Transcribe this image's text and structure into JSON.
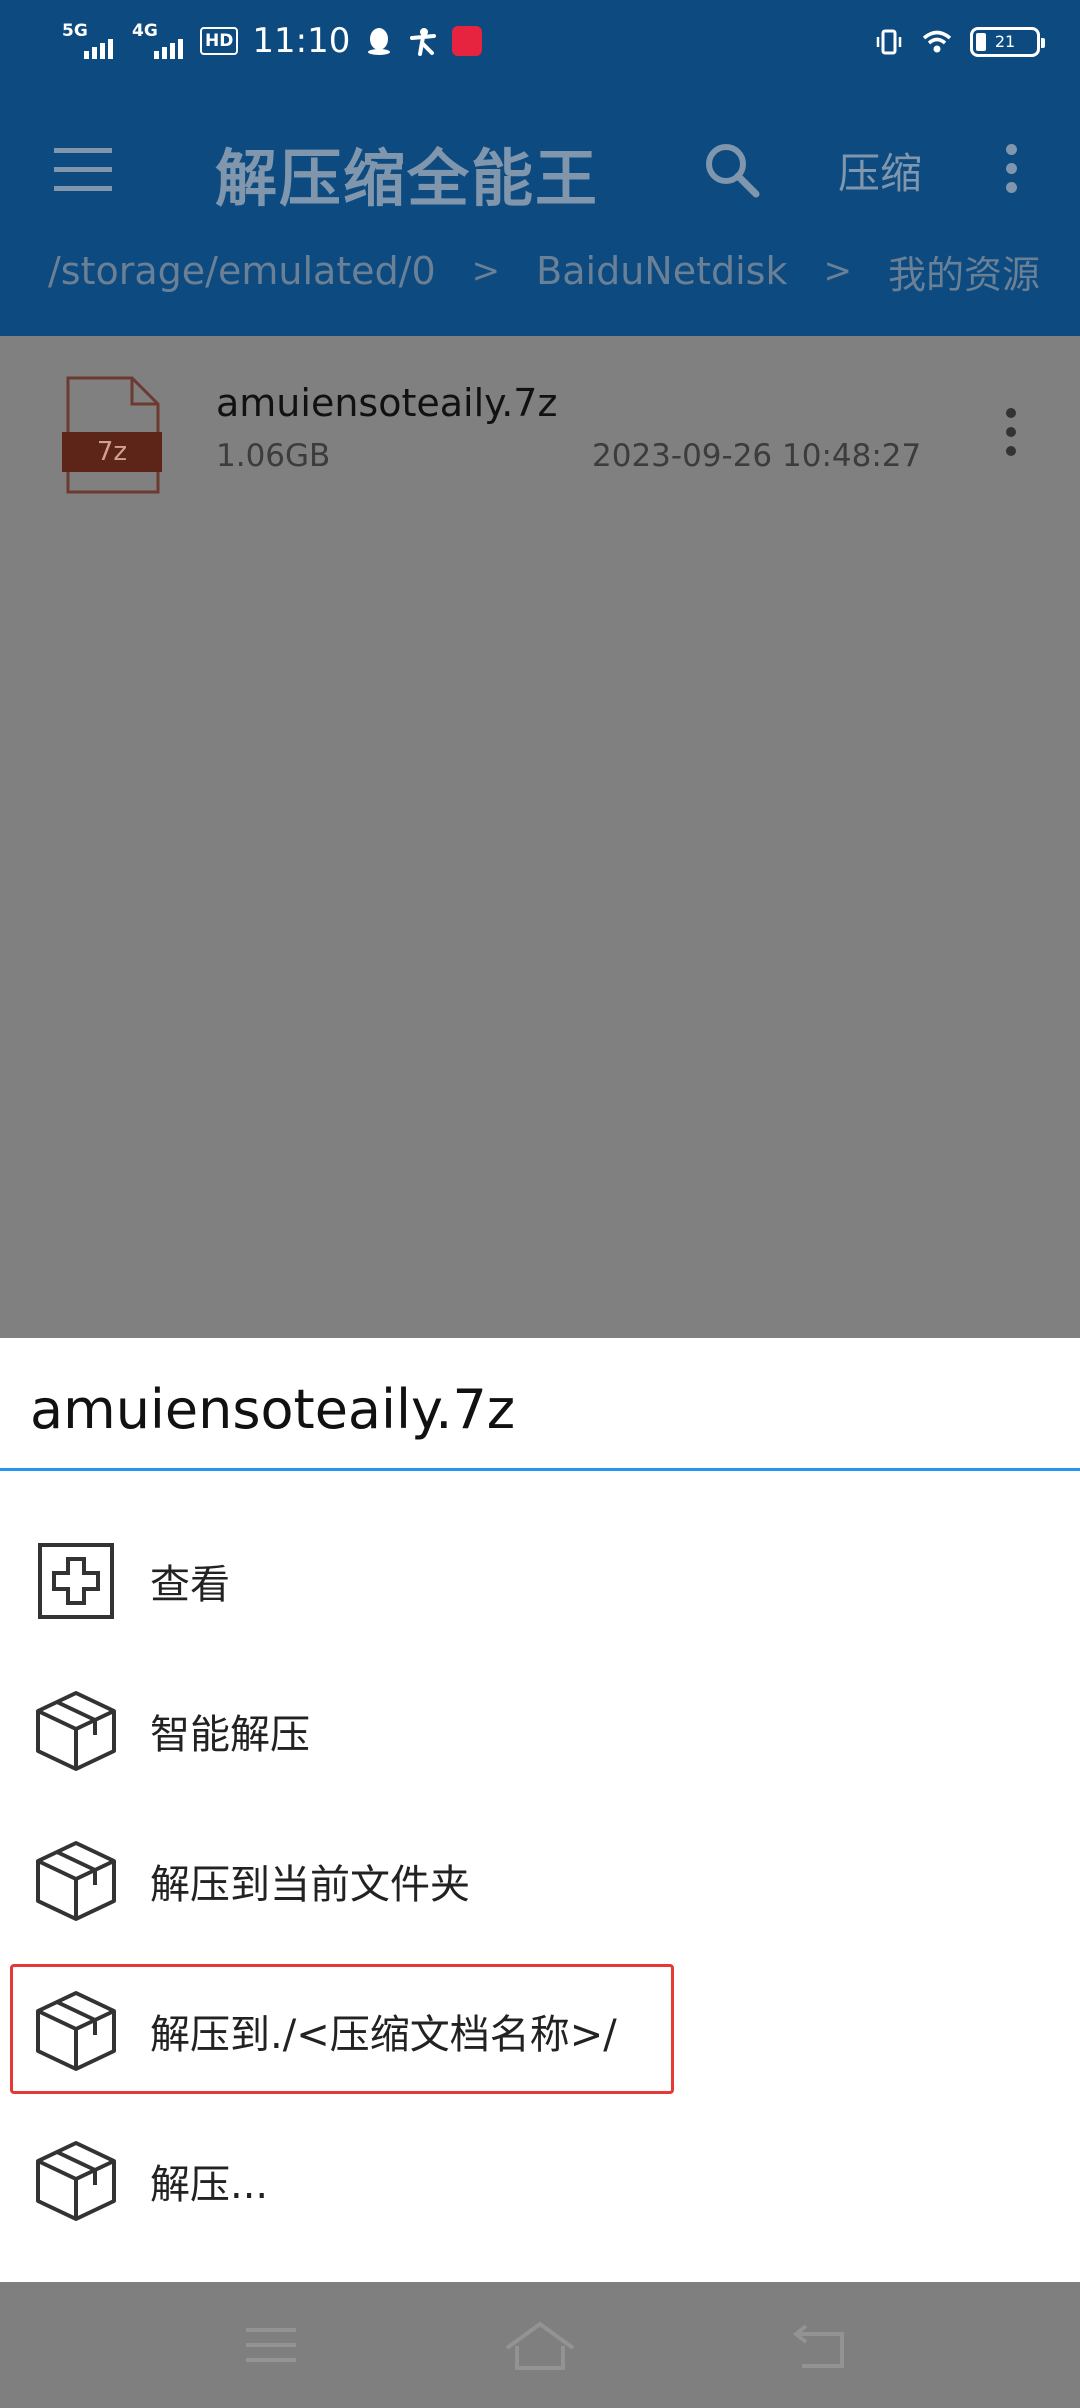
{
  "status_bar": {
    "sim1": "5G",
    "sim2": "4G",
    "hd": "HD",
    "time": "11:10",
    "battery": "21"
  },
  "app_bar": {
    "title": "解压缩全能王",
    "compress_label": "压缩"
  },
  "breadcrumb": {
    "path": "/storage/emulated/0",
    "folder1": "BaiduNetdisk",
    "folder2": "我的资源",
    "separator": ">"
  },
  "file": {
    "name": "amuiensoteaily.7z",
    "size": "1.06GB",
    "date": "2023-09-26  10:48:27",
    "badge": "7z"
  },
  "sheet": {
    "title": "amuiensoteaily.7z",
    "options": [
      {
        "label": "查看",
        "icon": "view-plus-icon"
      },
      {
        "label": "智能解压",
        "icon": "package-icon"
      },
      {
        "label": "解压到当前文件夹",
        "icon": "package-icon"
      },
      {
        "label": "解压到./<压缩文档名称>/",
        "icon": "package-icon"
      },
      {
        "label": "解压...",
        "icon": "package-icon"
      }
    ]
  },
  "colors": {
    "app_bar": "#0c4a7f",
    "accent": "#2196f3",
    "highlight": "#e53935",
    "file_badge": "#b5381a"
  }
}
